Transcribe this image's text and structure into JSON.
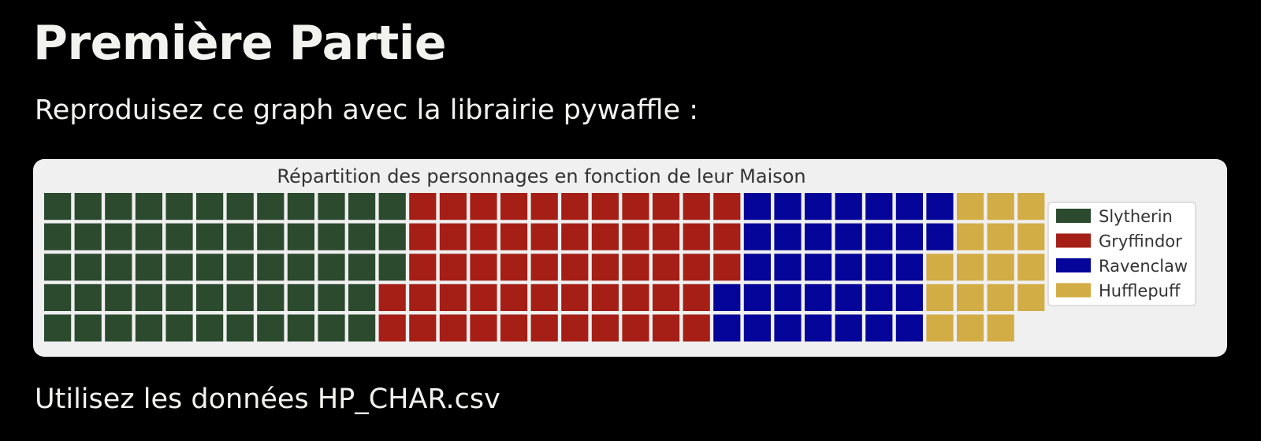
{
  "page": {
    "heading": "Première Partie",
    "instruction": "Reproduisez ce graph avec la librairie pywaffle :",
    "footer_text": "Utilisez les données HP_CHAR.csv"
  },
  "chart_data": {
    "type": "waffle",
    "title": "Répartition des personnages en fonction de leur Maison",
    "rows": 5,
    "fill_order": "column-major, top-to-bottom",
    "categories": [
      "Slytherin",
      "Gryffindor",
      "Ravenclaw",
      "Hufflepuff"
    ],
    "values": [
      58,
      55,
      34,
      17
    ],
    "colors": [
      "#2b4a2e",
      "#a51f16",
      "#050599",
      "#d2ac45"
    ],
    "legend": {
      "position": "right",
      "labels": [
        "Slytherin",
        "Gryffindor",
        "Ravenclaw",
        "Hufflepuff"
      ]
    }
  }
}
